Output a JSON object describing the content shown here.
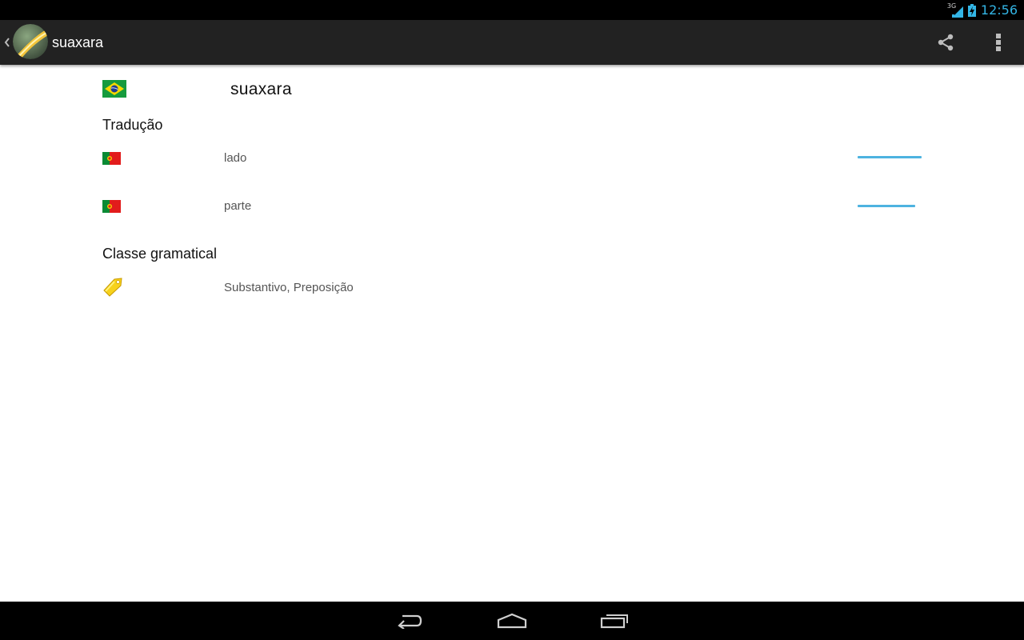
{
  "status_bar": {
    "network": "3G",
    "time": "12:56"
  },
  "action_bar": {
    "title": "suaxara",
    "icons": [
      "app-logo-icon",
      "share-icon",
      "overflow-menu-icon"
    ]
  },
  "entry": {
    "word": "suaxara",
    "source_flag": "brazil-flag-icon",
    "translation_section": "Tradução",
    "translations": [
      {
        "flag": "portugal-flag-icon",
        "text": "lado",
        "relevance": 1.0
      },
      {
        "flag": "portugal-flag-icon",
        "text": "parte",
        "relevance": 0.9
      }
    ],
    "grammar_section": "Classe gramatical",
    "grammar_icon": "tag-icon",
    "grammar_value": "Substantivo, Preposição"
  },
  "colors": {
    "accent": "#33b5e5",
    "relevance_bar": "#4db3e0",
    "action_bar_bg": "#222222"
  },
  "nav_bar": {
    "icons": [
      "back-icon",
      "home-icon",
      "recent-apps-icon"
    ]
  }
}
